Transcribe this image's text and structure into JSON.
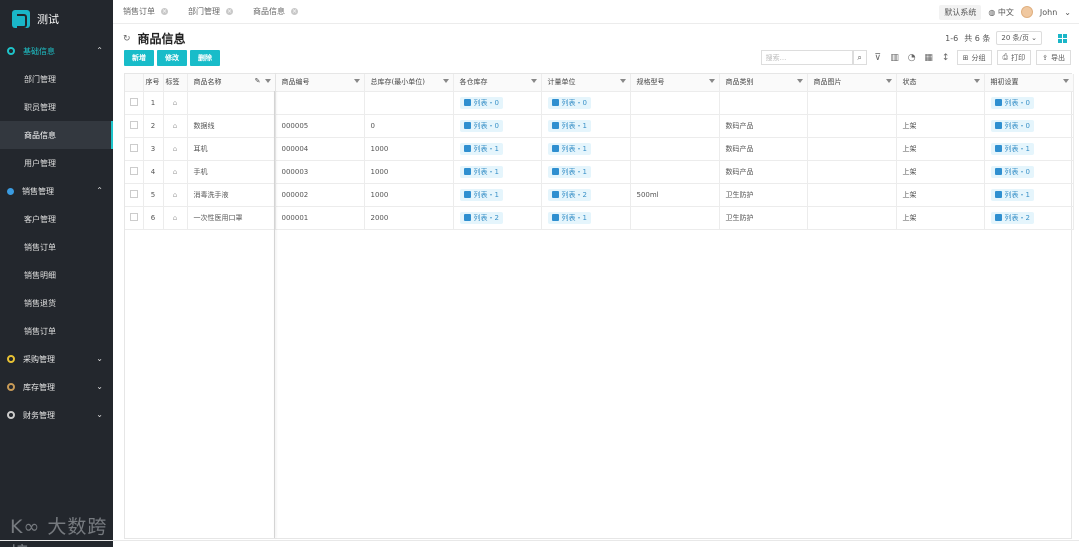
{
  "app": {
    "name": "测试",
    "watermark": "大数跨境"
  },
  "sidebar": {
    "groups": [
      {
        "label": "基础信息",
        "color": "#1ec3c9",
        "expanded": true,
        "items": [
          "部门管理",
          "职员管理",
          "商品信息",
          "用户管理"
        ]
      },
      {
        "label": "销售管理",
        "color": "#3a9be0",
        "expanded": true,
        "items": [
          "客户管理",
          "销售订单",
          "销售明细",
          "销售退货",
          "销售订单"
        ]
      },
      {
        "label": "采购管理",
        "color": "#e8c234",
        "expanded": false,
        "items": []
      },
      {
        "label": "库存管理",
        "color": "#c79a57",
        "expanded": false,
        "items": []
      },
      {
        "label": "财务管理",
        "color": "#cccccc",
        "expanded": false,
        "items": []
      }
    ],
    "active_item": "商品信息"
  },
  "tabs": [
    "销售订单",
    "部门管理",
    "商品信息"
  ],
  "topbar": {
    "system": "默认系统",
    "language": "中文",
    "user": "John"
  },
  "page": {
    "title": "商品信息",
    "pager": {
      "range": "1-6",
      "total": "共 6 条",
      "page_size": "20 条/页"
    },
    "buttons": {
      "add": "新增",
      "edit": "修改",
      "delete": "删除"
    },
    "search_placeholder": "搜索...",
    "group_label": "分组",
    "print_label": "打印",
    "export_label": "导出"
  },
  "table": {
    "headers": [
      "序号",
      "标签",
      "商品名称",
      "商品编号",
      "总库存(最小单位)",
      "各仓库存",
      "计量单位",
      "规格型号",
      "商品类别",
      "商品图片",
      "状态",
      "期初设置"
    ],
    "rows": [
      {
        "no": "1",
        "name": "",
        "code": "",
        "stock": "",
        "wh": "列表・0",
        "unit": "列表・0",
        "spec": "",
        "cat": "",
        "img": "",
        "status": "",
        "init": "列表・0"
      },
      {
        "no": "2",
        "name": "数据线",
        "code": "000005",
        "stock": "0",
        "wh": "列表・0",
        "unit": "列表・1",
        "spec": "",
        "cat": "数码产品",
        "img": "",
        "status": "上架",
        "init": "列表・0"
      },
      {
        "no": "3",
        "name": "耳机",
        "code": "000004",
        "stock": "1000",
        "wh": "列表・1",
        "unit": "列表・1",
        "spec": "",
        "cat": "数码产品",
        "img": "",
        "status": "上架",
        "init": "列表・1"
      },
      {
        "no": "4",
        "name": "手机",
        "code": "000003",
        "stock": "1000",
        "wh": "列表・1",
        "unit": "列表・1",
        "spec": "",
        "cat": "数码产品",
        "img": "",
        "status": "上架",
        "init": "列表・0"
      },
      {
        "no": "5",
        "name": "消毒洗手液",
        "code": "000002",
        "stock": "1000",
        "wh": "列表・1",
        "unit": "列表・2",
        "spec": "500ml",
        "cat": "卫生防护",
        "img": "",
        "status": "上架",
        "init": "列表・1"
      },
      {
        "no": "6",
        "name": "一次性医用口罩",
        "code": "000001",
        "stock": "2000",
        "wh": "列表・2",
        "unit": "列表・1",
        "spec": "",
        "cat": "卫生防护",
        "img": "",
        "status": "上架",
        "init": "列表・2"
      }
    ]
  },
  "colors": {
    "accent": "#18bcc9",
    "sidebar_bg": "#23272d",
    "chip_bg": "#e5f5fc",
    "chip_text": "#3a91c8"
  }
}
